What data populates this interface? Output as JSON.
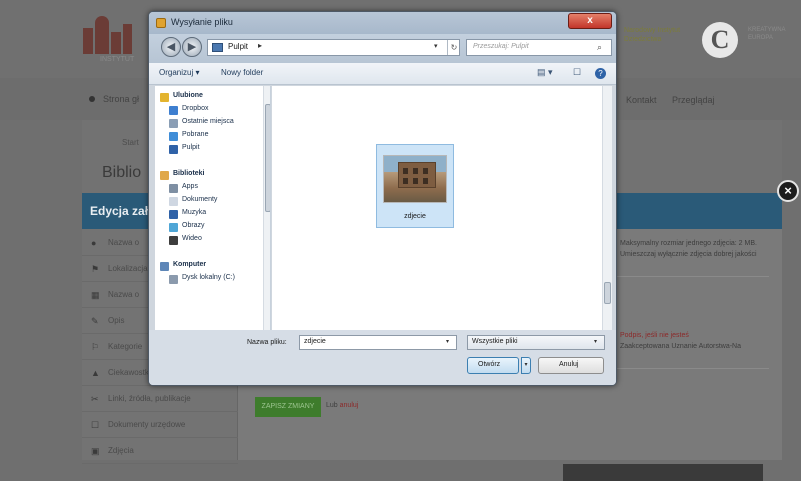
{
  "background_page": {
    "header_right_text": "Narodowy Instytut Dziedzictwa",
    "logo_c_letter": "C",
    "logo_c_text": "KREATYWNA EUROPA",
    "logo_small_text": "INSTYTUT",
    "nav_left": "Strona gł",
    "nav_right1": "Kontakt",
    "nav_right2": "Przeglądaj",
    "breadcrumb": "Start",
    "page_title": "Biblio"
  },
  "edit_modal": {
    "title": "Edycja zał",
    "close_glyph": "×",
    "left_items": [
      {
        "icon": "●",
        "label": "Nazwa o"
      },
      {
        "icon": "⚑",
        "label": "Lokalizacja"
      },
      {
        "icon": "▦",
        "label": "Nazwa o"
      },
      {
        "icon": "✎",
        "label": "Opis"
      },
      {
        "icon": "⚐",
        "label": "Kategorie"
      },
      {
        "icon": "▲",
        "label": "Ciekawostki"
      },
      {
        "icon": "✂",
        "label": "Linki, źródła, publikacje"
      },
      {
        "icon": "☐",
        "label": "Dokumenty urzędowe"
      },
      {
        "icon": "▣",
        "label": "Zdjęcia"
      }
    ],
    "right_text1": "Maksymalny rozmiar jednego zdjęcia: 2 MB. Umieszczaj wyłącznie zdjęcia dobrej jakości",
    "right_red": "Podpis, jeśli nie jesteś",
    "right_text2": "Zaakceptowana Uznanie Autorstwa-Na",
    "save_label": "ZAPISZ ZMIANY",
    "or_text": "Lub",
    "cancel_label": "anuluj"
  },
  "file_dialog": {
    "title": "Wysyłanie pliku",
    "close_glyph": "x",
    "back_glyph": "◀",
    "forward_glyph": "▶",
    "address": {
      "location": "Pulpit",
      "separator": "▸",
      "dropdown": "▾",
      "refresh": "↻"
    },
    "search_placeholder": "Przeszukaj: Pulpit",
    "toolbar": {
      "organize": "Organizuj ▾",
      "new_folder": "Nowy folder",
      "view_icon": "▤ ▾",
      "preview_icon": "☐",
      "help_icon": "?"
    },
    "nav_pane": [
      {
        "label": "Ulubione",
        "color": "#e3b42f",
        "indent": 0,
        "bold": true
      },
      {
        "label": "Dropbox",
        "color": "#3e7fd0",
        "indent": 1
      },
      {
        "label": "Ostatnie miejsca",
        "color": "#8a9eb5",
        "indent": 1
      },
      {
        "label": "Pobrane",
        "color": "#3f8dd8",
        "indent": 1
      },
      {
        "label": "Pulpit",
        "color": "#2f62a8",
        "indent": 1
      },
      {
        "label": "",
        "color": "",
        "indent": 0
      },
      {
        "label": "Biblioteki",
        "color": "#e0a84a",
        "indent": 0,
        "bold": true
      },
      {
        "label": "Apps",
        "color": "#7e8fa3",
        "indent": 1
      },
      {
        "label": "Dokumenty",
        "color": "#cfd7e2",
        "indent": 1
      },
      {
        "label": "Muzyka",
        "color": "#2f62a8",
        "indent": 1
      },
      {
        "label": "Obrazy",
        "color": "#4fa6d6",
        "indent": 1
      },
      {
        "label": "Wideo",
        "color": "#3d3d3d",
        "indent": 1
      },
      {
        "label": "",
        "color": "",
        "indent": 0
      },
      {
        "label": "Komputer",
        "color": "#5e86b7",
        "indent": 0,
        "bold": true
      },
      {
        "label": "Dysk lokalny (C:)",
        "color": "#8b9aad",
        "indent": 1
      }
    ],
    "file_item": {
      "name": "zdjecie"
    },
    "filename_label": "Nazwa pliku:",
    "filename_value": "zdjecie",
    "filetype_value": "Wszystkie pliki",
    "open_label": "Otwórz",
    "cancel_label": "Anuluj",
    "dropdown_glyph": "▾"
  },
  "colors": {
    "modal_header": "#2a5a78",
    "save_button": "#3e7c2c",
    "dialog_close": "#c2352a",
    "selection": "#cde4f7"
  }
}
